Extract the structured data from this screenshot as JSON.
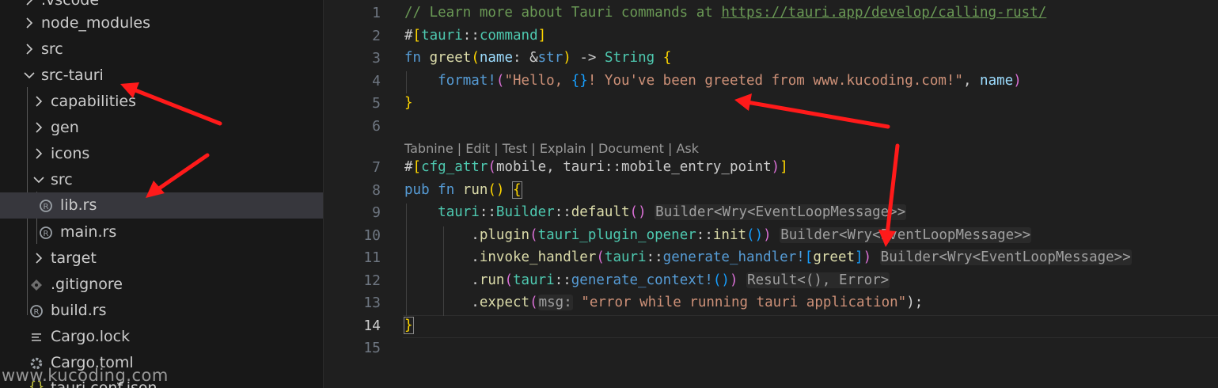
{
  "explorer": {
    "items": [
      {
        "label": ".vscode",
        "depth": 0,
        "kind": "folder",
        "expanded": false
      },
      {
        "label": "node_modules",
        "depth": 0,
        "kind": "folder",
        "expanded": false
      },
      {
        "label": "src",
        "depth": 0,
        "kind": "folder",
        "expanded": false
      },
      {
        "label": "src-tauri",
        "depth": 0,
        "kind": "folder",
        "expanded": true
      },
      {
        "label": "capabilities",
        "depth": 1,
        "kind": "folder",
        "expanded": false
      },
      {
        "label": "gen",
        "depth": 1,
        "kind": "folder",
        "expanded": false
      },
      {
        "label": "icons",
        "depth": 1,
        "kind": "folder",
        "expanded": false
      },
      {
        "label": "src",
        "depth": 1,
        "kind": "folder",
        "expanded": true
      },
      {
        "label": "lib.rs",
        "depth": 2,
        "kind": "rust",
        "selected": true
      },
      {
        "label": "main.rs",
        "depth": 2,
        "kind": "rust"
      },
      {
        "label": "target",
        "depth": 1,
        "kind": "folder",
        "expanded": false
      },
      {
        "label": ".gitignore",
        "depth": 1,
        "kind": "git"
      },
      {
        "label": "build.rs",
        "depth": 1,
        "kind": "rust"
      },
      {
        "label": "Cargo.lock",
        "depth": 1,
        "kind": "lock"
      },
      {
        "label": "Cargo.toml",
        "depth": 1,
        "kind": "gear"
      },
      {
        "label": "tauri.conf.json",
        "depth": 1,
        "kind": "json"
      }
    ]
  },
  "watermark": "www.kucoding.com",
  "editor": {
    "active_line": 14,
    "line_numbers": [
      "1",
      "2",
      "3",
      "4",
      "5",
      "6",
      "7",
      "8",
      "9",
      "10",
      "11",
      "12",
      "13",
      "14",
      "15"
    ],
    "codelens": [
      "Tabnine",
      "Edit",
      "Test",
      "Explain",
      "Document",
      "Ask"
    ],
    "codelens_separator": " | ",
    "code": {
      "l1_comment": "// Learn more about Tauri commands at ",
      "l1_link": "https://tauri.app/develop/calling-rust/",
      "l2_hash": "#",
      "l2_open": "[",
      "l2_tauri": "tauri",
      "l2_sep": "::",
      "l2_command": "command",
      "l2_close": "]",
      "l3_fn": "fn",
      "l3_name": "greet",
      "l3_paren_open": "(",
      "l3_param": "name",
      "l3_colon": ": &",
      "l3_str": "str",
      "l3_paren_close": ")",
      "l3_arrow": " -> ",
      "l3_ret": "String",
      "l3_brace": "{",
      "l4_format": "format!",
      "l4_paren_open": "(",
      "l4_str1": "\"Hello, ",
      "l4_placeholder": "{}",
      "l4_str2": "! You've been greeted from www.kucoding.com!\"",
      "l4_comma": ", ",
      "l4_name": "name",
      "l4_paren_close": ")",
      "l5_brace": "}",
      "l7_hash": "#",
      "l7_open": "[",
      "l7_cfg": "cfg_attr",
      "l7_paren_open": "(",
      "l7_mobile": "mobile",
      "l7_comma": ", ",
      "l7_tauri": "tauri",
      "l7_sep": "::",
      "l7_entry": "mobile_entry_point",
      "l7_paren_close": ")",
      "l7_close": "]",
      "l8_pub": "pub",
      "l8_fn": "fn",
      "l8_run": "run",
      "l8_parens": "()",
      "l8_brace": "{",
      "l9_tauri": "tauri",
      "l9_sep1": "::",
      "l9_builder": "Builder",
      "l9_sep2": "::",
      "l9_default": "default",
      "l9_parens": "()",
      "l9_hint": "Builder<Wry<EventLoopMessage>>",
      "l10_dot": ".",
      "l10_plugin": "plugin",
      "l10_paren_open": "(",
      "l10_mod": "tauri_plugin_opener",
      "l10_sep": "::",
      "l10_init": "init",
      "l10_inner": "()",
      "l10_paren_close": ")",
      "l10_hint": "Builder<Wry<EventLoopMessage>>",
      "l11_dot": ".",
      "l11_invoke": "invoke_handler",
      "l11_paren_open": "(",
      "l11_tauri": "tauri",
      "l11_sep": "::",
      "l11_gen": "generate_handler!",
      "l11_bracket_open": "[",
      "l11_greet": "greet",
      "l11_bracket_close": "]",
      "l11_paren_close": ")",
      "l11_hint": "Builder<Wry<EventLoopMessage>>",
      "l12_dot": ".",
      "l12_run": "run",
      "l12_paren_open": "(",
      "l12_tauri": "tauri",
      "l12_sep": "::",
      "l12_ctx": "generate_context!",
      "l12_inner": "()",
      "l12_paren_close": ")",
      "l12_hint": "Result<(), Error>",
      "l13_dot": ".",
      "l13_expect": "expect",
      "l13_paren_open": "(",
      "l13_hint": "msg:",
      "l13_str": "\"error while running tauri application\"",
      "l13_end": ");",
      "l14_brace": "}"
    }
  },
  "annotation_color": "#ff1a1a"
}
